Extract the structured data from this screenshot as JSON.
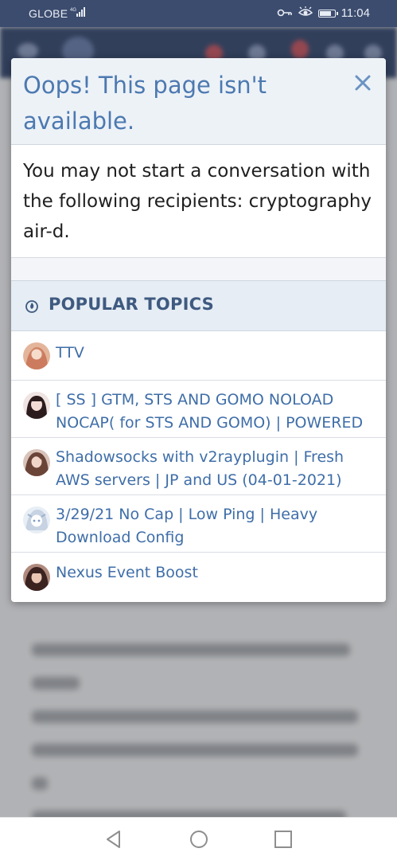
{
  "status_bar": {
    "carrier": "GLOBE",
    "network": "4G",
    "time": "11:04",
    "icons": [
      "signal-icon",
      "key-icon",
      "eye-icon",
      "battery-icon"
    ]
  },
  "modal": {
    "title": "Oops! This page isn't available.",
    "close_icon": "close-icon",
    "message": "You may not start a conversation with the following recipients: cryptography air-d."
  },
  "popular_topics": {
    "icon": "flame-icon",
    "title": "POPULAR TOPICS",
    "items": [
      {
        "label": "TTV",
        "avatar_color": "#d88a6a"
      },
      {
        "label": "[ SS ] GTM, STS AND GOMO NOLOAD NOCAP( for STS AND GOMO) | POWERED",
        "avatar_color": "#6b3a3a"
      },
      {
        "label": "Shadowsocks with v2rayplugin | Fresh AWS servers | JP and US (04-01-2021)",
        "avatar_color": "#7a5448"
      },
      {
        "label": "3/29/21 No Cap | Low Ping | Heavy Download Config",
        "avatar_color": "#b9c7d8"
      },
      {
        "label": "Nexus Event Boost",
        "avatar_color": "#5a3430"
      }
    ]
  },
  "nav_bar": {
    "back_icon": "back-icon",
    "home_icon": "home-icon",
    "recents_icon": "recents-icon"
  },
  "colors": {
    "accent": "#4c79b0",
    "link": "#3f6ea8",
    "header_bg": "#3c4c6e"
  }
}
